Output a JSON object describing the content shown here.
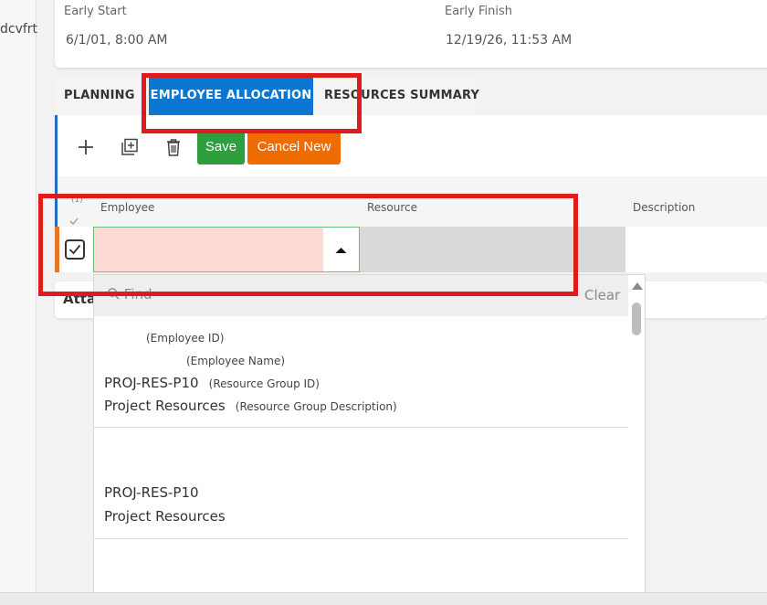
{
  "left_rail": {
    "truncated_text": "dcvfrt"
  },
  "header": {
    "early_start_label": "Early Start",
    "early_start_value": "6/1/01, 8:00 AM",
    "early_finish_label": "Early Finish",
    "early_finish_value": "12/19/26, 11:53 AM"
  },
  "tabs": [
    {
      "label": "PLANNING"
    },
    {
      "label": "EMPLOYEE ALLOCATION"
    },
    {
      "label": "RESOURCES SUMMARY"
    }
  ],
  "toolbar": {
    "add_icon": "plus-icon",
    "duplicate_icon": "duplicate-icon",
    "delete_icon": "trash-icon",
    "save_label": "Save",
    "cancel_label": "Cancel New"
  },
  "grid": {
    "columns": {
      "employee": "Employee",
      "resource": "Resource",
      "description": "Description"
    },
    "selection_header": "(1)"
  },
  "attachments": {
    "label": "Atta"
  },
  "dropdown": {
    "find_placeholder": "Find",
    "clear_label": "Clear",
    "items": [
      {
        "employee_id_hint": "(Employee ID)",
        "employee_name_hint": "(Employee Name)",
        "group_id": "PROJ-RES-P10",
        "group_id_hint": "(Resource Group ID)",
        "group_desc": "Project Resources",
        "group_desc_hint": "(Resource Group Description)"
      },
      {
        "group_id": "PROJ-RES-P10",
        "group_desc": "Project Resources"
      }
    ]
  },
  "colors": {
    "tab_active": "#0b77d3",
    "save": "#2e9e3e",
    "cancel": "#ef6c00",
    "highlight_box": "#e01b1b",
    "required_field": "#fbdad5"
  }
}
